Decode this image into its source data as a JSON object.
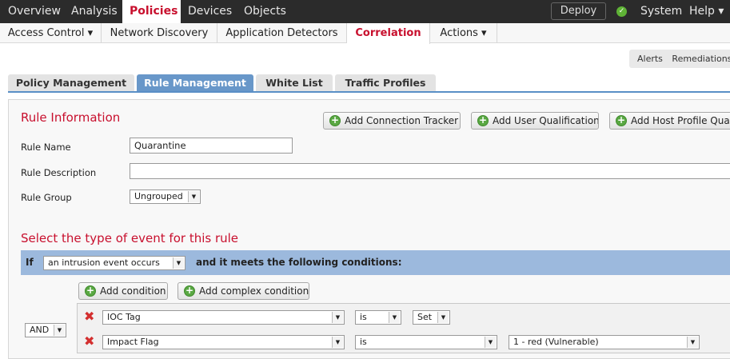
{
  "top_nav": {
    "items": [
      "Overview",
      "Analysis",
      "Policies",
      "Devices",
      "Objects"
    ],
    "deploy_label": "Deploy",
    "system_label": "System",
    "help_label": "Help ▾"
  },
  "sub_nav": {
    "items": [
      "Access Control ▾",
      "Network Discovery",
      "Application Detectors",
      "Correlation",
      "Actions ▾"
    ]
  },
  "right_bar": {
    "alerts": "Alerts",
    "remediations": "Remediations"
  },
  "tabs": [
    "Policy Management",
    "Rule Management",
    "White List",
    "Traffic Profiles"
  ],
  "rule_info": {
    "title": "Rule Information",
    "buttons": [
      "Add Connection Tracker",
      "Add User Qualification",
      "Add Host Profile Qualification"
    ],
    "name_label": "Rule Name",
    "name_value": "Quarantine",
    "description_label": "Rule Description",
    "description_value": "",
    "group_label": "Rule Group",
    "group_value": "Ungrouped"
  },
  "event_section": {
    "title": "Select the type of event for this rule",
    "if_label": "If",
    "event_value": "an intrusion event occurs",
    "conditions_text": "and it meets the following conditions:",
    "add_condition": "Add condition",
    "add_complex_condition": "Add complex condition",
    "operator": "AND",
    "conditions": [
      {
        "field": "IOC Tag",
        "op": "is",
        "value": "Set"
      },
      {
        "field": "Impact Flag",
        "op": "is",
        "value": "1 - red (Vulnerable)"
      }
    ]
  }
}
